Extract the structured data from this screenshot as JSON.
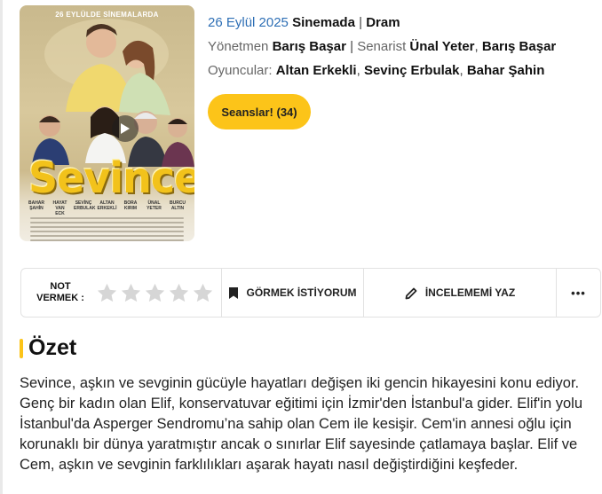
{
  "poster": {
    "tagline": "26 EYLÜLDE SİNEMALARDA",
    "title_word": "Sevince",
    "cast": [
      "BAHAR ŞAHİN",
      "HAYAT VAN ECK",
      "SEVİNÇ ERBULAK",
      "ALTAN ERKEKLİ",
      "BORA KIRIM",
      "ÜNAL YETER",
      "BURCU ALTIN"
    ]
  },
  "info": {
    "date": "26 Eylül 2025",
    "release_label": "Sinemada",
    "separator": "|",
    "genre": "Dram",
    "director_label": "Yönetmen",
    "director": "Barış Başar",
    "writer_label": "Senarist",
    "writers": [
      "Ünal Yeter",
      "Barış Başar"
    ],
    "cast_label": "Oyuncular:",
    "cast": [
      "Altan Erkekli",
      "Sevinç Erbulak",
      "Bahar Şahin"
    ]
  },
  "seans_button": "Seanslar! (34)",
  "action_bar": {
    "rate_label": "NOT VERMEK :",
    "stars_total": 5,
    "stars_filled": 0,
    "want_label": "GÖRMEK İSTİYORUM",
    "review_label": "İNCELEMEMİ YAZ",
    "more_label": "•••"
  },
  "summary": {
    "title": "Özet",
    "text": "Sevince, aşkın ve sevginin gücüyle hayatları değişen iki gencin hikayesini konu ediyor. Genç bir kadın olan Elif, konservatuvar eğitimi için İzmir'den İstanbul'a gider. Elif'in yolu İstanbul'da Asperger Sendromu’na sahip olan Cem ile kesişir. Cem'in annesi oğlu için korunaklı bir dünya yaratmıştır ancak o sınırlar Elif sayesinde çatlamaya başlar. Elif ve Cem, aşkın ve sevginin farklılıkları aşarak hayatı nasıl değiştirdiğini keşfeder."
  },
  "colors": {
    "accent": "#fcc419",
    "date": "#2e6fb5",
    "star_empty": "#d6d6d6"
  },
  "icons": [
    "play-icon",
    "star-icon",
    "bookmark-icon",
    "pencil-icon",
    "more-icon"
  ]
}
